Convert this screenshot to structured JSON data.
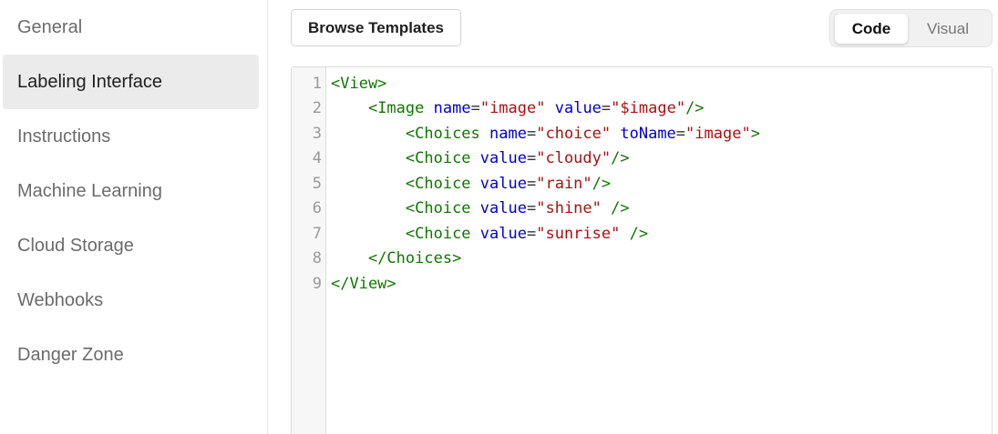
{
  "sidebar": {
    "items": [
      {
        "label": "General",
        "active": false
      },
      {
        "label": "Labeling Interface",
        "active": true
      },
      {
        "label": "Instructions",
        "active": false
      },
      {
        "label": "Machine Learning",
        "active": false
      },
      {
        "label": "Cloud Storage",
        "active": false
      },
      {
        "label": "Webhooks",
        "active": false
      },
      {
        "label": "Danger Zone",
        "active": false
      }
    ]
  },
  "toolbar": {
    "browse_label": "Browse Templates",
    "toggle": {
      "code_label": "Code",
      "visual_label": "Visual",
      "selected": "Code"
    }
  },
  "editor": {
    "line_numbers": [
      "1",
      "2",
      "3",
      "4",
      "5",
      "6",
      "7",
      "8",
      "9"
    ],
    "lines": [
      [
        {
          "t": "tag",
          "v": "<View>"
        }
      ],
      [
        {
          "t": "ws",
          "v": "    "
        },
        {
          "t": "tag",
          "v": "<Image"
        },
        {
          "t": "ws",
          "v": " "
        },
        {
          "t": "attr",
          "v": "name"
        },
        {
          "t": "eq",
          "v": "="
        },
        {
          "t": "str",
          "v": "\"image\""
        },
        {
          "t": "ws",
          "v": " "
        },
        {
          "t": "attr",
          "v": "value"
        },
        {
          "t": "eq",
          "v": "="
        },
        {
          "t": "str",
          "v": "\"$image\""
        },
        {
          "t": "tag",
          "v": "/>"
        }
      ],
      [
        {
          "t": "ws",
          "v": "        "
        },
        {
          "t": "tag",
          "v": "<Choices"
        },
        {
          "t": "ws",
          "v": " "
        },
        {
          "t": "attr",
          "v": "name"
        },
        {
          "t": "eq",
          "v": "="
        },
        {
          "t": "str",
          "v": "\"choice\""
        },
        {
          "t": "ws",
          "v": " "
        },
        {
          "t": "attr",
          "v": "toName"
        },
        {
          "t": "eq",
          "v": "="
        },
        {
          "t": "str",
          "v": "\"image\""
        },
        {
          "t": "tag",
          "v": ">"
        }
      ],
      [
        {
          "t": "ws",
          "v": "        "
        },
        {
          "t": "tag",
          "v": "<Choice"
        },
        {
          "t": "ws",
          "v": " "
        },
        {
          "t": "attr",
          "v": "value"
        },
        {
          "t": "eq",
          "v": "="
        },
        {
          "t": "str",
          "v": "\"cloudy\""
        },
        {
          "t": "tag",
          "v": "/>"
        }
      ],
      [
        {
          "t": "ws",
          "v": "        "
        },
        {
          "t": "tag",
          "v": "<Choice"
        },
        {
          "t": "ws",
          "v": " "
        },
        {
          "t": "attr",
          "v": "value"
        },
        {
          "t": "eq",
          "v": "="
        },
        {
          "t": "str",
          "v": "\"rain\""
        },
        {
          "t": "tag",
          "v": "/>"
        }
      ],
      [
        {
          "t": "ws",
          "v": "        "
        },
        {
          "t": "tag",
          "v": "<Choice"
        },
        {
          "t": "ws",
          "v": " "
        },
        {
          "t": "attr",
          "v": "value"
        },
        {
          "t": "eq",
          "v": "="
        },
        {
          "t": "str",
          "v": "\"shine\""
        },
        {
          "t": "ws",
          "v": " "
        },
        {
          "t": "tag",
          "v": "/>"
        }
      ],
      [
        {
          "t": "ws",
          "v": "        "
        },
        {
          "t": "tag",
          "v": "<Choice"
        },
        {
          "t": "ws",
          "v": " "
        },
        {
          "t": "attr",
          "v": "value"
        },
        {
          "t": "eq",
          "v": "="
        },
        {
          "t": "str",
          "v": "\"sunrise\""
        },
        {
          "t": "ws",
          "v": " "
        },
        {
          "t": "tag",
          "v": "/>"
        }
      ],
      [
        {
          "t": "ws",
          "v": "    "
        },
        {
          "t": "tag",
          "v": "</Choices>"
        }
      ],
      [
        {
          "t": "tag",
          "v": "</View>"
        }
      ]
    ]
  },
  "colors": {
    "tag": "#117700",
    "attr": "#0000cc",
    "string": "#aa1111",
    "active_nav_bg": "#ebebeb"
  }
}
